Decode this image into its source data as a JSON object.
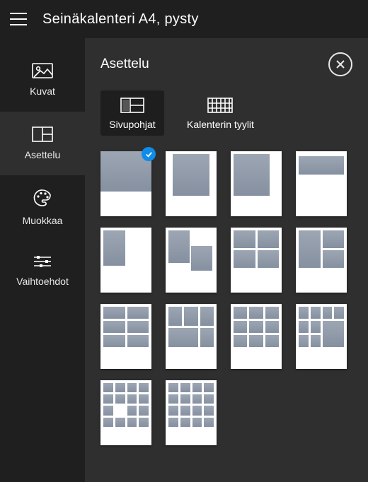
{
  "header": {
    "title": "Seinäkalenteri A4, pysty"
  },
  "sidebar": {
    "items": [
      {
        "key": "kuvat",
        "label": "Kuvat"
      },
      {
        "key": "asettelu",
        "label": "Asettelu"
      },
      {
        "key": "muokkaa",
        "label": "Muokkaa"
      },
      {
        "key": "vaihtoehdot",
        "label": "Vaihtoehdot"
      }
    ],
    "active": "asettelu"
  },
  "panel": {
    "title": "Asettelu",
    "tabs": [
      {
        "key": "sivupohjat",
        "label": "Sivupohjat"
      },
      {
        "key": "kalstyylit",
        "label": "Kalenterin tyylit"
      }
    ],
    "active_tab": "sivupohjat",
    "templates": [
      {
        "id": "full-top",
        "selected": true
      },
      {
        "id": "tall-center",
        "selected": false
      },
      {
        "id": "tall-right-margin",
        "selected": false
      },
      {
        "id": "wide-top-band",
        "selected": false
      },
      {
        "id": "small-top-left",
        "selected": false
      },
      {
        "id": "two-staggered",
        "selected": false
      },
      {
        "id": "grid-2x2",
        "selected": false
      },
      {
        "id": "grid-3-offset",
        "selected": false
      },
      {
        "id": "grid-2x3",
        "selected": false
      },
      {
        "id": "grid-3-row",
        "selected": false
      },
      {
        "id": "grid-3x3",
        "selected": false
      },
      {
        "id": "grid-4x3-offset",
        "selected": false
      },
      {
        "id": "grid-4x4-missing",
        "selected": false
      },
      {
        "id": "grid-4x4",
        "selected": false
      }
    ]
  }
}
